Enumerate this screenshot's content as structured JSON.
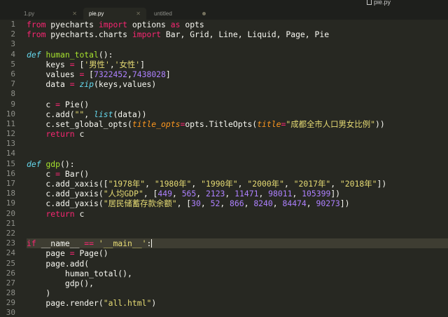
{
  "window": {
    "title": "pie.py"
  },
  "tabs": [
    {
      "label": "1.py",
      "active": false,
      "dirty": false
    },
    {
      "label": "pie.py",
      "active": true,
      "dirty": false
    },
    {
      "label": "untitled",
      "active": false,
      "dirty": true
    }
  ],
  "editor": {
    "current_line": 23,
    "lines": [
      {
        "n": "1",
        "t": [
          [
            "kw",
            "from"
          ],
          [
            "pl",
            " pyecharts "
          ],
          [
            "kw",
            "import"
          ],
          [
            "pl",
            " options "
          ],
          [
            "kw",
            "as"
          ],
          [
            "pl",
            " opts"
          ]
        ]
      },
      {
        "n": "2",
        "t": [
          [
            "kw",
            "from"
          ],
          [
            "pl",
            " pyecharts.charts "
          ],
          [
            "kw",
            "import"
          ],
          [
            "pl",
            " Bar, Grid, Line, Liquid, Page, Pie"
          ]
        ]
      },
      {
        "n": "3",
        "t": []
      },
      {
        "n": "4",
        "t": [
          [
            "def",
            "def"
          ],
          [
            "pl",
            " "
          ],
          [
            "fn",
            "human_total"
          ],
          [
            "pl",
            "():"
          ]
        ]
      },
      {
        "n": "5",
        "t": [
          [
            "pl",
            "    keys "
          ],
          [
            "op",
            "="
          ],
          [
            "pl",
            " ["
          ],
          [
            "str",
            "'男性'"
          ],
          [
            "pl",
            ","
          ],
          [
            "str",
            "'女性'"
          ],
          [
            "pl",
            "]"
          ]
        ]
      },
      {
        "n": "6",
        "t": [
          [
            "pl",
            "    values "
          ],
          [
            "op",
            "="
          ],
          [
            "pl",
            " ["
          ],
          [
            "num",
            "7322452"
          ],
          [
            "pl",
            ","
          ],
          [
            "num",
            "7438028"
          ],
          [
            "pl",
            "]"
          ]
        ]
      },
      {
        "n": "7",
        "t": [
          [
            "pl",
            "    data "
          ],
          [
            "op",
            "="
          ],
          [
            "pl",
            " "
          ],
          [
            "bi",
            "zip"
          ],
          [
            "pl",
            "(keys,values)"
          ]
        ]
      },
      {
        "n": "8",
        "t": []
      },
      {
        "n": "9",
        "t": [
          [
            "pl",
            "    c "
          ],
          [
            "op",
            "="
          ],
          [
            "pl",
            " Pie()"
          ]
        ]
      },
      {
        "n": "10",
        "t": [
          [
            "pl",
            "    c.add("
          ],
          [
            "str",
            "\"\""
          ],
          [
            "pl",
            ", "
          ],
          [
            "bi",
            "list"
          ],
          [
            "pl",
            "(data))"
          ]
        ]
      },
      {
        "n": "11",
        "t": [
          [
            "pl",
            "    c.set_global_opts("
          ],
          [
            "param",
            "title_opts"
          ],
          [
            "op",
            "="
          ],
          [
            "pl",
            "opts.TitleOpts("
          ],
          [
            "param",
            "title"
          ],
          [
            "op",
            "="
          ],
          [
            "str",
            "\"成都全市人口男女比例\""
          ],
          [
            "pl",
            "))"
          ]
        ]
      },
      {
        "n": "12",
        "t": [
          [
            "pl",
            "    "
          ],
          [
            "kw",
            "return"
          ],
          [
            "pl",
            " c"
          ]
        ]
      },
      {
        "n": "13",
        "t": []
      },
      {
        "n": "14",
        "t": []
      },
      {
        "n": "15",
        "t": [
          [
            "def",
            "def"
          ],
          [
            "pl",
            " "
          ],
          [
            "fn",
            "gdp"
          ],
          [
            "pl",
            "():"
          ]
        ]
      },
      {
        "n": "16",
        "t": [
          [
            "pl",
            "    c "
          ],
          [
            "op",
            "="
          ],
          [
            "pl",
            " Bar()"
          ]
        ]
      },
      {
        "n": "17",
        "t": [
          [
            "pl",
            "    c.add_xaxis(["
          ],
          [
            "str",
            "\"1978年\""
          ],
          [
            "pl",
            ", "
          ],
          [
            "str",
            "\"1980年\""
          ],
          [
            "pl",
            ", "
          ],
          [
            "str",
            "\"1990年\""
          ],
          [
            "pl",
            ", "
          ],
          [
            "str",
            "\"2000年\""
          ],
          [
            "pl",
            ", "
          ],
          [
            "str",
            "\"2017年\""
          ],
          [
            "pl",
            ", "
          ],
          [
            "str",
            "\"2018年\""
          ],
          [
            "pl",
            "])"
          ]
        ]
      },
      {
        "n": "18",
        "t": [
          [
            "pl",
            "    c.add_yaxis("
          ],
          [
            "str",
            "\"人均GDP\""
          ],
          [
            "pl",
            ", ["
          ],
          [
            "num",
            "449"
          ],
          [
            "pl",
            ", "
          ],
          [
            "num",
            "565"
          ],
          [
            "pl",
            ", "
          ],
          [
            "num",
            "2123"
          ],
          [
            "pl",
            ", "
          ],
          [
            "num",
            "11471"
          ],
          [
            "pl",
            ", "
          ],
          [
            "num",
            "98011"
          ],
          [
            "pl",
            ", "
          ],
          [
            "num",
            "105399"
          ],
          [
            "pl",
            "])"
          ]
        ]
      },
      {
        "n": "19",
        "t": [
          [
            "pl",
            "    c.add_yaxis("
          ],
          [
            "str",
            "\"居民储蓄存款余额\""
          ],
          [
            "pl",
            ", ["
          ],
          [
            "num",
            "30"
          ],
          [
            "pl",
            ", "
          ],
          [
            "num",
            "52"
          ],
          [
            "pl",
            ", "
          ],
          [
            "num",
            "866"
          ],
          [
            "pl",
            ", "
          ],
          [
            "num",
            "8240"
          ],
          [
            "pl",
            ", "
          ],
          [
            "num",
            "84474"
          ],
          [
            "pl",
            ", "
          ],
          [
            "num",
            "90273"
          ],
          [
            "pl",
            "])"
          ]
        ]
      },
      {
        "n": "20",
        "t": [
          [
            "pl",
            "    "
          ],
          [
            "kw",
            "return"
          ],
          [
            "pl",
            " c"
          ]
        ]
      },
      {
        "n": "21",
        "t": []
      },
      {
        "n": "22",
        "t": []
      },
      {
        "n": "23",
        "t": [
          [
            "kw",
            "if"
          ],
          [
            "pl",
            " __name__ "
          ],
          [
            "op",
            "=="
          ],
          [
            "pl",
            " "
          ],
          [
            "str",
            "'__main__'"
          ],
          [
            "pl",
            ":"
          ]
        ]
      },
      {
        "n": "24",
        "t": [
          [
            "pl",
            "    page "
          ],
          [
            "op",
            "="
          ],
          [
            "pl",
            " Page()"
          ]
        ]
      },
      {
        "n": "25",
        "t": [
          [
            "pl",
            "    page.add("
          ]
        ]
      },
      {
        "n": "26",
        "t": [
          [
            "pl",
            "        human_total(),"
          ]
        ]
      },
      {
        "n": "27",
        "t": [
          [
            "pl",
            "        gdp(),"
          ]
        ]
      },
      {
        "n": "28",
        "t": [
          [
            "pl",
            "    )"
          ]
        ]
      },
      {
        "n": "29",
        "t": [
          [
            "pl",
            "    page.render("
          ],
          [
            "str",
            "\"all.html\""
          ],
          [
            "pl",
            ")"
          ]
        ]
      },
      {
        "n": "30",
        "t": []
      }
    ]
  }
}
